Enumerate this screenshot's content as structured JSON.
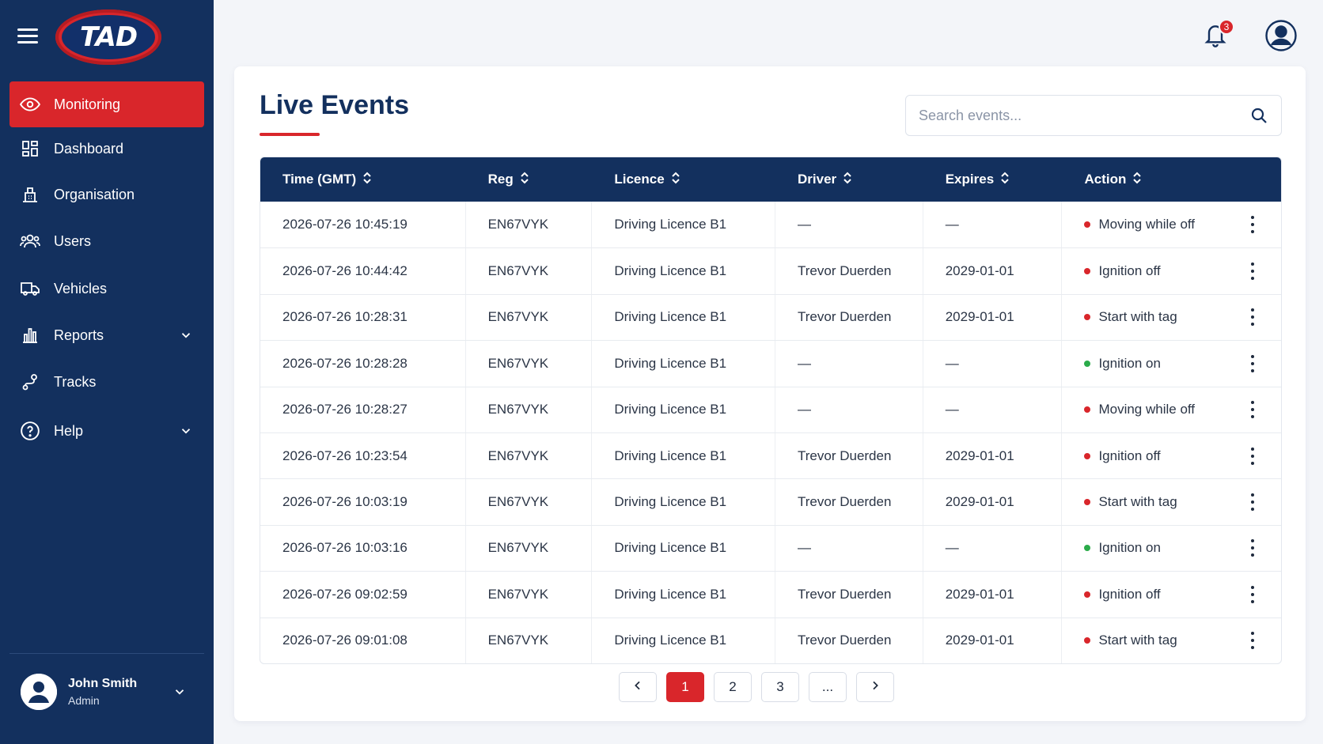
{
  "brand": {
    "logo_text": "TAD"
  },
  "sidebar": {
    "items": [
      {
        "label": "Monitoring",
        "icon": "eye-icon",
        "active": true
      },
      {
        "label": "Dashboard",
        "icon": "grid-icon"
      },
      {
        "label": "Organisation",
        "icon": "building-icon"
      },
      {
        "label": "Users",
        "icon": "users-icon"
      },
      {
        "label": "Vehicles",
        "icon": "truck-icon"
      },
      {
        "label": "Reports",
        "icon": "bar-chart-icon",
        "expandable": true
      },
      {
        "label": "Tracks",
        "icon": "route-icon"
      },
      {
        "label": "Help",
        "icon": "question-icon",
        "expandable": true
      }
    ],
    "user": {
      "name": "John Smith",
      "role": "Admin"
    }
  },
  "topbar": {
    "notification_count": "3"
  },
  "main": {
    "title": "Live Events",
    "search": {
      "placeholder": "Search events..."
    },
    "columns": [
      "Time (GMT)",
      "Reg",
      "Licence",
      "Driver",
      "Expires",
      "Action"
    ],
    "rows": [
      {
        "time": "2026-07-26 10:45:19",
        "reg": "EN67VYK",
        "licence": "Driving Licence B1",
        "driver": "—",
        "expires": "—",
        "action": "Moving while off",
        "status": "red"
      },
      {
        "time": "2026-07-26 10:44:42",
        "reg": "EN67VYK",
        "licence": "Driving Licence B1",
        "driver": "Trevor Duerden",
        "expires": "2029-01-01",
        "action": "Ignition off",
        "status": "red"
      },
      {
        "time": "2026-07-26 10:28:31",
        "reg": "EN67VYK",
        "licence": "Driving Licence B1",
        "driver": "Trevor Duerden",
        "expires": "2029-01-01",
        "action": "Start with tag",
        "status": "red"
      },
      {
        "time": "2026-07-26 10:28:28",
        "reg": "EN67VYK",
        "licence": "Driving Licence B1",
        "driver": "—",
        "expires": "—",
        "action": "Ignition on",
        "status": "green"
      },
      {
        "time": "2026-07-26 10:28:27",
        "reg": "EN67VYK",
        "licence": "Driving Licence B1",
        "driver": "—",
        "expires": "—",
        "action": "Moving while off",
        "status": "red"
      },
      {
        "time": "2026-07-26 10:23:54",
        "reg": "EN67VYK",
        "licence": "Driving Licence B1",
        "driver": "Trevor Duerden",
        "expires": "2029-01-01",
        "action": "Ignition off",
        "status": "red"
      },
      {
        "time": "2026-07-26 10:03:19",
        "reg": "EN67VYK",
        "licence": "Driving Licence B1",
        "driver": "Trevor Duerden",
        "expires": "2029-01-01",
        "action": "Start with tag",
        "status": "red"
      },
      {
        "time": "2026-07-26 10:03:16",
        "reg": "EN67VYK",
        "licence": "Driving Licence B1",
        "driver": "—",
        "expires": "—",
        "action": "Ignition on",
        "status": "green"
      },
      {
        "time": "2026-07-26 09:02:59",
        "reg": "EN67VYK",
        "licence": "Driving Licence B1",
        "driver": "Trevor Duerden",
        "expires": "2029-01-01",
        "action": "Ignition off",
        "status": "red"
      },
      {
        "time": "2026-07-26 09:01:08",
        "reg": "EN67VYK",
        "licence": "Driving Licence B1",
        "driver": "Trevor Duerden",
        "expires": "2029-01-01",
        "action": "Start with tag",
        "status": "red"
      }
    ],
    "pagination": {
      "pages": [
        "1",
        "2",
        "3",
        "..."
      ],
      "current": "1"
    }
  },
  "colors": {
    "navy": "#13305e",
    "red": "#d9262b",
    "green": "#2bab4a",
    "status_red": "#d9262b"
  }
}
